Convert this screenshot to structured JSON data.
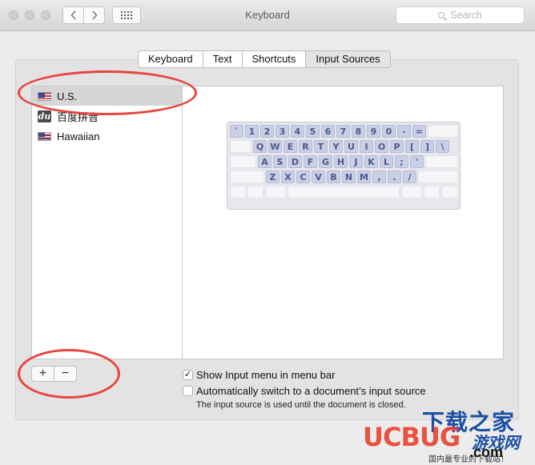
{
  "window": {
    "title": "Keyboard"
  },
  "search": {
    "placeholder": "Search"
  },
  "tabs": [
    {
      "label": "Keyboard",
      "active": false
    },
    {
      "label": "Text",
      "active": false
    },
    {
      "label": "Shortcuts",
      "active": false
    },
    {
      "label": "Input Sources",
      "active": true
    }
  ],
  "input_sources": [
    {
      "label": "U.S.",
      "icon": "us-flag-icon",
      "selected": true
    },
    {
      "label": "百度拼音",
      "icon": "baidu-du-icon",
      "selected": false
    },
    {
      "label": "Hawaiian",
      "icon": "hawaii-flag-icon",
      "selected": false
    }
  ],
  "keyboard_layout": {
    "row1": [
      "`",
      "1",
      "2",
      "3",
      "4",
      "5",
      "6",
      "7",
      "8",
      "9",
      "0",
      "-",
      "="
    ],
    "row2": [
      "Q",
      "W",
      "E",
      "R",
      "T",
      "Y",
      "U",
      "I",
      "O",
      "P",
      "[",
      "]",
      "\\"
    ],
    "row3": [
      "A",
      "S",
      "D",
      "F",
      "G",
      "H",
      "J",
      "K",
      "L",
      ";",
      "'"
    ],
    "row4": [
      "Z",
      "X",
      "C",
      "V",
      "B",
      "N",
      "M",
      ",",
      ".",
      "/"
    ]
  },
  "buttons": {
    "add": "+",
    "remove": "−"
  },
  "options": {
    "show_input_menu": {
      "label": "Show Input menu in menu bar",
      "checked": true
    },
    "auto_switch": {
      "label": "Automatically switch to a document’s input source",
      "checked": false
    }
  },
  "note": "The input source is used until the document is closed.",
  "watermark": {
    "line1": "下载之家",
    "brand": "UCBUG",
    "game": "游戏网",
    "domain": ".com",
    "tagline": "国内最专业的下载站！"
  },
  "colors": {
    "annotation_red": "#e8453f",
    "key_fill": "#c9cfe6",
    "key_text": "#4b5a8a",
    "selection": "#d6d6d6"
  }
}
